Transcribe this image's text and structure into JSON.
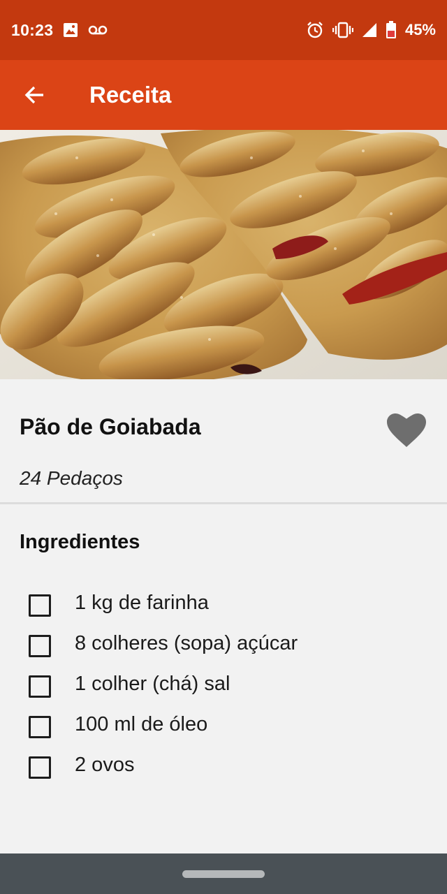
{
  "status_bar": {
    "time": "10:23",
    "battery": "45%",
    "icons": [
      "image-icon",
      "voicemail-icon",
      "alarm-icon",
      "vibrate-icon",
      "signal-icon",
      "battery-icon"
    ]
  },
  "app_bar": {
    "title": "Receita",
    "back_icon": "arrow-back-icon"
  },
  "recipe": {
    "title": "Pão de Goiabada",
    "portions": "24 Pedaços",
    "favorite_icon": "heart-icon",
    "ingredients_title": "Ingredientes",
    "ingredients": [
      {
        "label": "1 kg de farinha",
        "checked": false
      },
      {
        "label": "8 colheres (sopa) açúcar",
        "checked": false
      },
      {
        "label": "1 colher (chá) sal",
        "checked": false
      },
      {
        "label": "100 ml de óleo",
        "checked": false
      },
      {
        "label": "2 ovos",
        "checked": false
      }
    ]
  },
  "colors": {
    "status_bar": "#c3390f",
    "app_bar": "#db4416",
    "background": "#f2f2f2",
    "heart": "#6e6e6e",
    "nav_bar": "#4a5156"
  }
}
